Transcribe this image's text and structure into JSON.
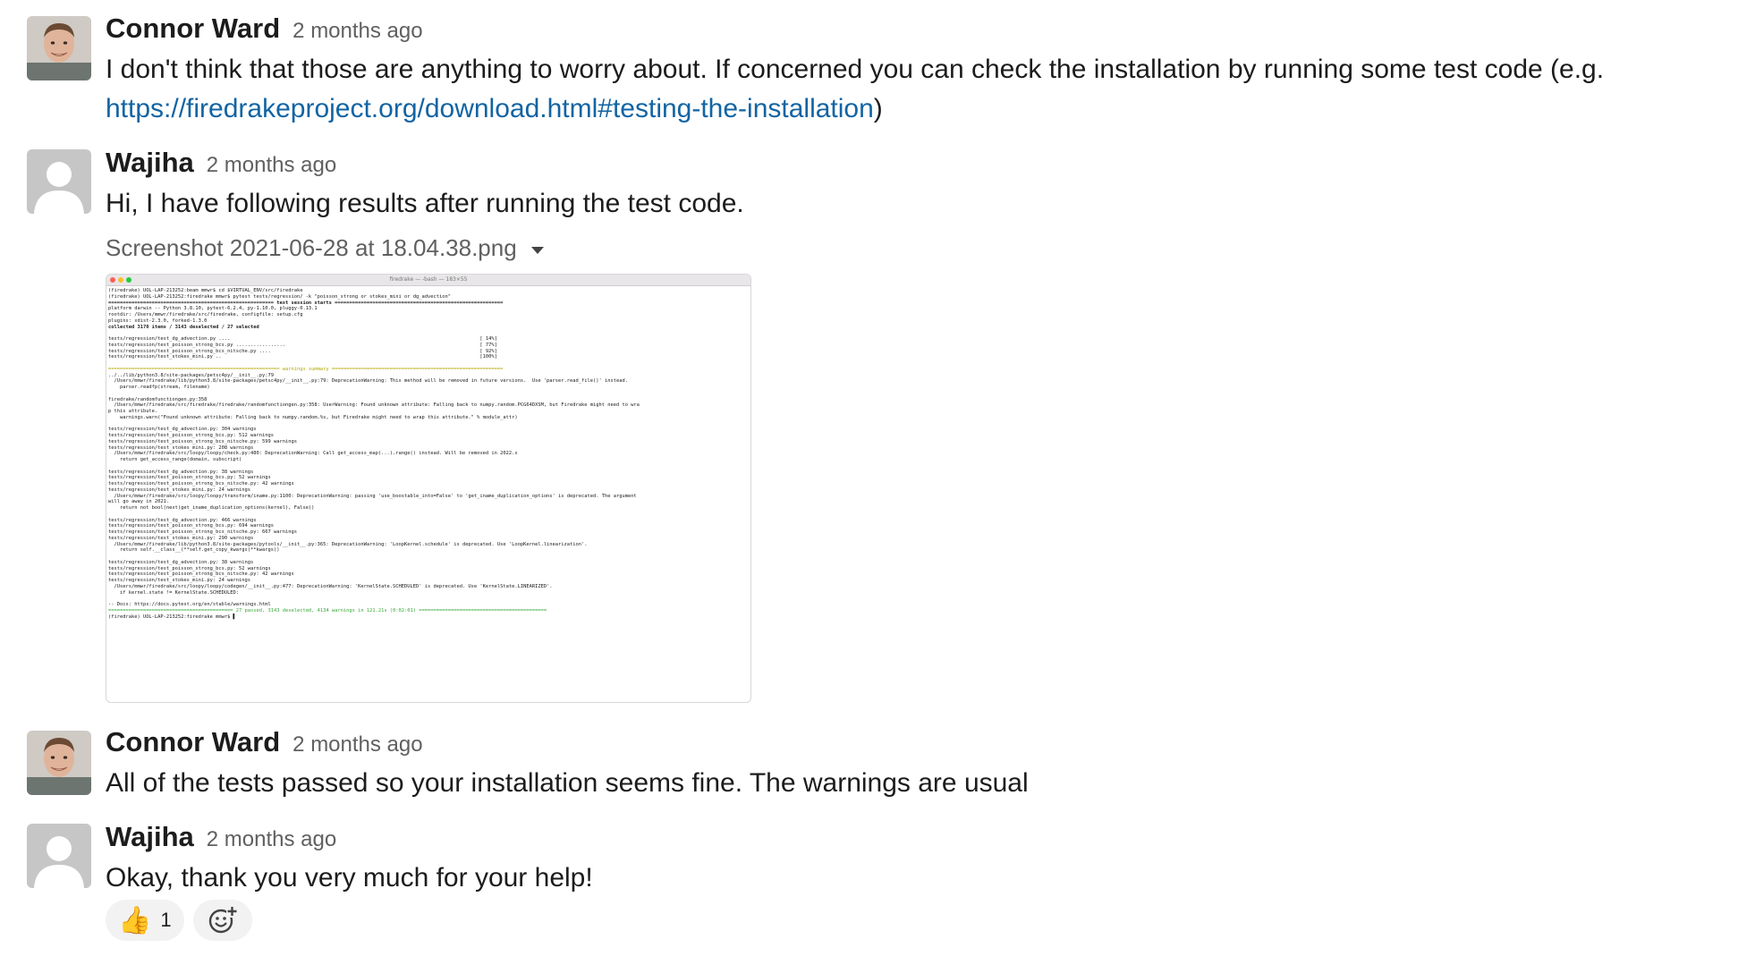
{
  "messages": [
    {
      "author": "Connor Ward",
      "time": "2 months ago",
      "text_pre": "I don't think that those are anything to worry about. If concerned you can check the installation by running some test code (e.g.",
      "link": "https://firedrakeproject.org/download.html#testing-the-installation",
      "text_post": ")"
    },
    {
      "author": "Wajiha",
      "time": "2 months ago",
      "text": "Hi, I have following results after running the test code.",
      "attachment": {
        "file_name": "Screenshot 2021-06-28 at 18.04.38.png",
        "terminal_title": "firedrake — -bash — 183×55",
        "terminal_lines": [
          "(firedrake) UOL-LAP-213252:beam mmwr$ cd $VIRTUAL_ENV/src/firedrake",
          "(firedrake) UOL-LAP-213252:firedrake mmwr$ pytest tests/regression/ -k \"poisson_strong or stokes_mini or dg_advection\"",
          "========================================================= test session starts ==========================================================",
          "platform darwin -- Python 3.8.10, pytest-6.2.4, py-1.10.0, pluggy-0.13.1",
          "rootdir: /Users/mmwr/firedrake/src/firedrake, configfile: setup.cfg",
          "plugins: xdist-2.3.0, forked-1.3.0",
          "collected 3170 items / 3143 deselected / 27 selected",
          "",
          "tests/regression/test_dg_advection.py ....                                                                                      [ 14%]",
          "tests/regression/test_poisson_strong_bcs.py .................                                                                   [ 77%]",
          "tests/regression/test_poisson_strong_bcs_nitsche.py ....                                                                        [ 92%]",
          "tests/regression/test_stokes_mini.py ..                                                                                         [100%]",
          "",
          "=========================================================== warnings summary ===========================================================",
          "../../lib/python3.8/site-packages/petsc4py/__init__.py:79",
          "  /Users/mmwr/firedrake/lib/python3.8/site-packages/petsc4py/__init__.py:79: DeprecationWarning: This method will be removed in future versions.  Use 'parser.read_file()' instead.",
          "    parser.readfp(stream, filename)",
          "",
          "firedrake/randomfunctiongen.py:358",
          "  /Users/mmwr/firedrake/src/firedrake/firedrake/randomfunctiongen.py:358: UserWarning: Found unknown attribute: Falling back to numpy.random.PCG64DXSM, but Firedrake might need to wra",
          "p this attribute.",
          "    warnings.warn(\"Found unknown attribute: Falling back to numpy.random.%s, but Firedrake might need to wrap this attribute.\" % module_attr)",
          "",
          "tests/regression/test_dg_advection.py: 304 warnings",
          "tests/regression/test_poisson_strong_bcs.py: 512 warnings",
          "tests/regression/test_poisson_strong_bcs_nitsche.py: 599 warnings",
          "tests/regression/test_stokes_mini.py: 208 warnings",
          "  /Users/mmwr/firedrake/src/loopy/loopy/check.py:480: DeprecationWarning: Call get_access_map(...).range() instead. Will be removed in 2022.x",
          "    return get_access_range(domain, subscript)",
          "",
          "tests/regression/test_dg_advection.py: 38 warnings",
          "tests/regression/test_poisson_strong_bcs.py: 52 warnings",
          "tests/regression/test_poisson_strong_bcs_nitsche.py: 42 warnings",
          "tests/regression/test_stokes_mini.py: 24 warnings",
          "  /Users/mmwr/firedrake/src/loopy/loopy/transform/iname.py:1100: DeprecationWarning: passing 'use_boostable_into=False' to 'get_iname_duplication_options' is deprecated. The argument",
          "will go away in 2021.",
          "    return not bool(next(get_iname_duplication_options(kernel), False))",
          "",
          "tests/regression/test_dg_advection.py: 466 warnings",
          "tests/regression/test_poisson_strong_bcs.py: 694 warnings",
          "tests/regression/test_poisson_strong_bcs_nitsche.py: 667 warnings",
          "tests/regression/test_stokes_mini.py: 290 warnings",
          "  /Users/mmwr/firedrake/lib/python3.8/site-packages/pytools/__init__.py:365: DeprecationWarning: 'LoopKernel.schedule' is deprecated. Use 'LoopKernel.linearization'.",
          "    return self.__class__(**self.get_copy_kwargs(**kwargs))",
          "",
          "tests/regression/test_dg_advection.py: 38 warnings",
          "tests/regression/test_poisson_strong_bcs.py: 52 warnings",
          "tests/regression/test_poisson_strong_bcs_nitsche.py: 42 warnings",
          "tests/regression/test_stokes_mini.py: 24 warnings",
          "  /Users/mmwr/firedrake/src/loopy/loopy/codegen/__init__.py:477: DeprecationWarning: 'KernelState.SCHEDULED' is deprecated. Use 'KernelState.LINEARIZED'.",
          "    if kernel.state != KernelState.SCHEDULED:",
          "",
          "-- Docs: https://docs.pytest.org/en/stable/warnings.html",
          "=========================================== 27 passed, 3143 deselected, 4134 warnings in 121.21s (0:02:01) ============================================",
          "(firedrake) UOL-LAP-213252:firedrake mmwr$ ▌"
        ]
      }
    },
    {
      "author": "Connor Ward",
      "time": "2 months ago",
      "text": "All of the tests passed so your installation seems fine. The warnings are usual"
    },
    {
      "author": "Wajiha",
      "time": "2 months ago",
      "text": "Okay, thank you very much for your help!",
      "reactions": [
        {
          "emoji": "👍",
          "icon": "thumbs-up-icon",
          "count": "1"
        }
      ]
    }
  ],
  "colors": {
    "link": "#1264a3",
    "timestamp": "#616061",
    "text": "#1d1c1d"
  }
}
